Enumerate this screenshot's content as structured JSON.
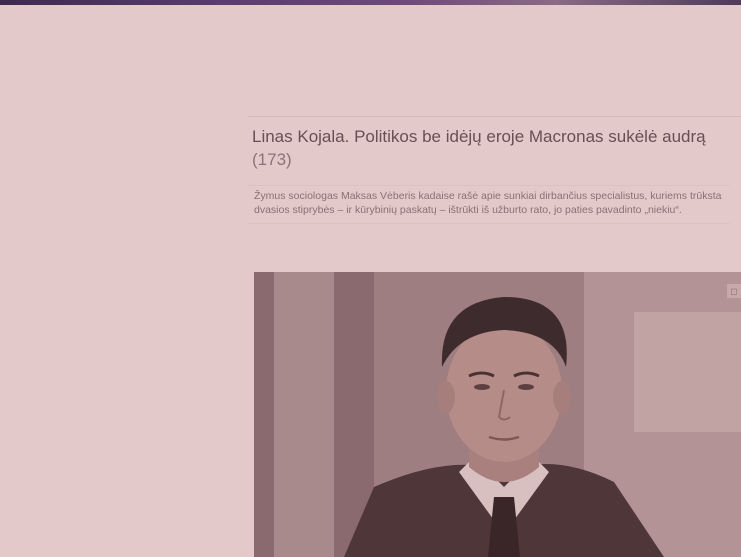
{
  "article": {
    "title": "Linas Kojala. Politikos be idėjų eroje Macronas sukėlė audrą",
    "comment_count": "(173)",
    "lead": "Žymus sociologas Maksas Vėberis kadaise rašė apie sunkiai dirbančius specialistus, kuriems trūksta dvasios stiprybės – ir kūrybinių paskatų – ištrūkti iš užburto rato, jo paties pavadinto „niekiu“."
  },
  "colors": {
    "background": "#e4c9ca",
    "title_text": "#6a4f52",
    "lead_text": "#8b6f72"
  }
}
